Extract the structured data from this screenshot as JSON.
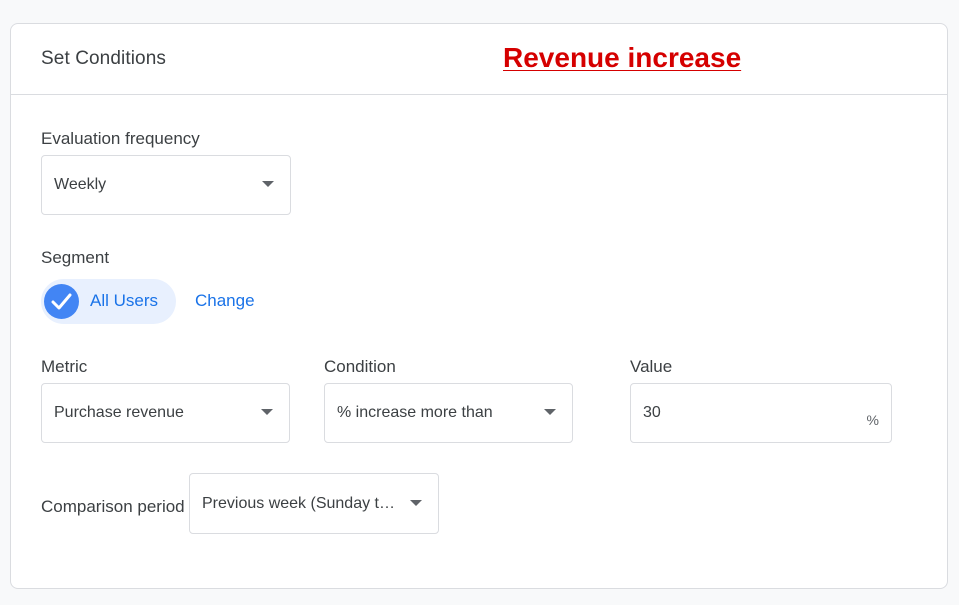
{
  "card": {
    "title": "Set Conditions",
    "annotation": "Revenue increase"
  },
  "evaluation_frequency": {
    "label": "Evaluation frequency",
    "value": "Weekly"
  },
  "segment": {
    "label": "Segment",
    "chip_label": "All Users",
    "change_label": "Change"
  },
  "metric": {
    "label": "Metric",
    "value": "Purchase revenue"
  },
  "condition": {
    "label": "Condition",
    "value": "% increase more than"
  },
  "value_field": {
    "label": "Value",
    "value": "30",
    "suffix": "%"
  },
  "comparison_period": {
    "label": "Comparison period",
    "value": "Previous week (Sunday to …"
  },
  "colors": {
    "accent": "#1a73e8",
    "check_bg": "#4285f4",
    "chip_bg": "#e8f0fe",
    "annotation": "#d50000",
    "border": "#dadce0"
  }
}
